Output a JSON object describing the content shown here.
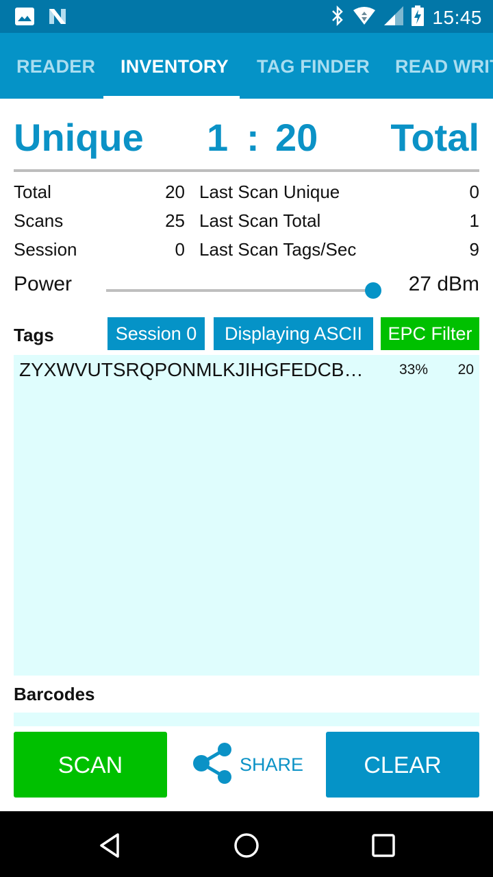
{
  "status_bar": {
    "time": "15:45",
    "left_icons": [
      "image-notification-icon",
      "n-notification-icon"
    ],
    "right_icons": [
      "bluetooth-icon",
      "wifi-icon",
      "cell-signal-icon",
      "battery-charging-icon"
    ]
  },
  "tabs": [
    {
      "label": "READER",
      "active": false
    },
    {
      "label": "INVENTORY",
      "active": true
    },
    {
      "label": "TAG FINDER",
      "active": false
    },
    {
      "label": "READ WRITE",
      "active": false
    }
  ],
  "ratio": {
    "left_label": "Unique",
    "unique": "1",
    "separator": ":",
    "total": "20",
    "right_label": "Total"
  },
  "stats": {
    "left": [
      {
        "label": "Total",
        "value": "20"
      },
      {
        "label": "Scans",
        "value": "25"
      },
      {
        "label": "Session",
        "value": "0"
      }
    ],
    "right": [
      {
        "label": "Last Scan Unique",
        "value": "0"
      },
      {
        "label": "Last Scan Total",
        "value": "1"
      },
      {
        "label": "Last Scan Tags/Sec",
        "value": "9"
      }
    ]
  },
  "power": {
    "label": "Power",
    "value_text": "27 dBm",
    "slider_fraction": 1.0
  },
  "tags": {
    "label": "Tags",
    "chips": {
      "session": "Session 0",
      "display_mode": "Displaying ASCII",
      "filter": "EPC Filter"
    },
    "rows": [
      {
        "epc": "ZYXWVUTSRQPONMLKJIHGFEDCB…",
        "percent": "33%",
        "count": "20"
      }
    ]
  },
  "barcodes": {
    "label": "Barcodes",
    "rows": []
  },
  "actions": {
    "scan": "SCAN",
    "share": "SHARE",
    "clear": "CLEAR"
  },
  "colors": {
    "status_bar": "#0277A8",
    "primary": "#0593C7",
    "accent_green": "#00C000",
    "list_bg": "#DFFDFD"
  }
}
